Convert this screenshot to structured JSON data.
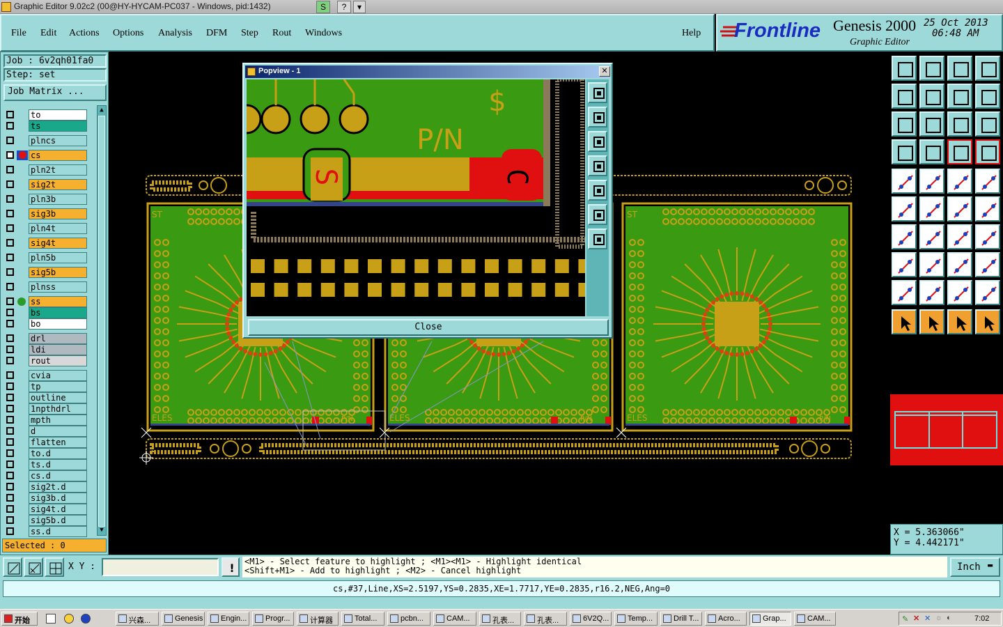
{
  "window": {
    "title": "Graphic Editor 9.02c2 (00@HY-HYCAM-PC037 - Windows, pid:1432)"
  },
  "menu": [
    "File",
    "Edit",
    "Actions",
    "Options",
    "Analysis",
    "DFM",
    "Step",
    "Rout",
    "Windows"
  ],
  "help": "Help",
  "brand": {
    "logo": "Frontline",
    "product": "Genesis 2000",
    "subtitle": "Graphic Editor",
    "date": "25 Oct 2013",
    "time": "06:48 AM"
  },
  "job": {
    "job_line": "Job : 6v2qh01fa0",
    "step_line": "Step: set",
    "matrix_button": "Job Matrix ..."
  },
  "layers": [
    {
      "name": "to",
      "color": "#ffffff"
    },
    {
      "name": "ts",
      "color": "#1aa88a"
    },
    {
      "name": "plncs",
      "color": "#9ed9d9"
    },
    {
      "name": "cs",
      "color": "#f5b030",
      "selected": true
    },
    {
      "name": "pln2t",
      "color": "#9ed9d9"
    },
    {
      "name": "sig2t",
      "color": "#f5b030"
    },
    {
      "name": "pln3b",
      "color": "#9ed9d9"
    },
    {
      "name": "sig3b",
      "color": "#f5b030"
    },
    {
      "name": "pln4t",
      "color": "#9ed9d9"
    },
    {
      "name": "sig4t",
      "color": "#f5b030"
    },
    {
      "name": "pln5b",
      "color": "#9ed9d9"
    },
    {
      "name": "sig5b",
      "color": "#f5b030"
    },
    {
      "name": "plnss",
      "color": "#9ed9d9"
    },
    {
      "name": "ss",
      "color": "#f5b030"
    },
    {
      "name": "bs",
      "color": "#1aa88a"
    },
    {
      "name": "bo",
      "color": "#ffffff"
    },
    {
      "name": "drl",
      "color": "#b0b8c0"
    },
    {
      "name": "ldi",
      "color": "#b0b8c0"
    },
    {
      "name": "rout",
      "color": "#d8d8d8"
    },
    {
      "name": "cvia",
      "color": "#9ed9d9"
    },
    {
      "name": "tp",
      "color": "#9ed9d9"
    },
    {
      "name": "outline",
      "color": "#9ed9d9"
    },
    {
      "name": "1npthdrl",
      "color": "#9ed9d9"
    },
    {
      "name": "mpth",
      "color": "#9ed9d9"
    },
    {
      "name": "d",
      "color": "#9ed9d9"
    },
    {
      "name": "flatten",
      "color": "#9ed9d9"
    },
    {
      "name": "to.d",
      "color": "#9ed9d9"
    },
    {
      "name": "ts.d",
      "color": "#9ed9d9"
    },
    {
      "name": "cs.d",
      "color": "#9ed9d9"
    },
    {
      "name": "sig2t.d",
      "color": "#9ed9d9"
    },
    {
      "name": "sig3b.d",
      "color": "#9ed9d9"
    },
    {
      "name": "sig4t.d",
      "color": "#9ed9d9"
    },
    {
      "name": "sig5b.d",
      "color": "#9ed9d9"
    },
    {
      "name": "ss.d",
      "color": "#9ed9d9"
    }
  ],
  "selected_count": "Selected : 0",
  "popup": {
    "title": "Popview - 1",
    "close": "Close",
    "silk_pn": "P/N"
  },
  "board": {
    "label_st": "ST",
    "label_eles": "ELES",
    "label_pn": "P/N"
  },
  "coords": {
    "x": "X  =  5.363066\"",
    "y": "Y  =  4.442171\""
  },
  "cmd": {
    "xy_label": "X Y :",
    "xy_value": "",
    "hint1": "<M1> - Select feature to highlight ; <M1><M1> - Highlight identical",
    "hint2": "<Shift+M1> - Add to highlight ; <M2> - Cancel highlight",
    "units": "Inch"
  },
  "status": "cs,#37,Line,XS=2.5197,YS=0.2835,XE=1.7717,YE=0.2835,r16.2,NEG,Ang=0",
  "taskbar": {
    "start": "开始",
    "items": [
      "兴森...",
      "Genesis",
      "Engin...",
      "Progr...",
      "计算器",
      "Total...",
      "pcbn...",
      "CAM...",
      "孔表...",
      "孔表...",
      "6V2Q...",
      "Temp...",
      "Drill T...",
      "Acro...",
      "Grap...",
      "CAM..."
    ],
    "clock": "7:02"
  },
  "colors": {
    "panel": "#9ed9d9",
    "board_green": "#3a9a12",
    "copper": "#c8a018",
    "red": "#e01010"
  }
}
